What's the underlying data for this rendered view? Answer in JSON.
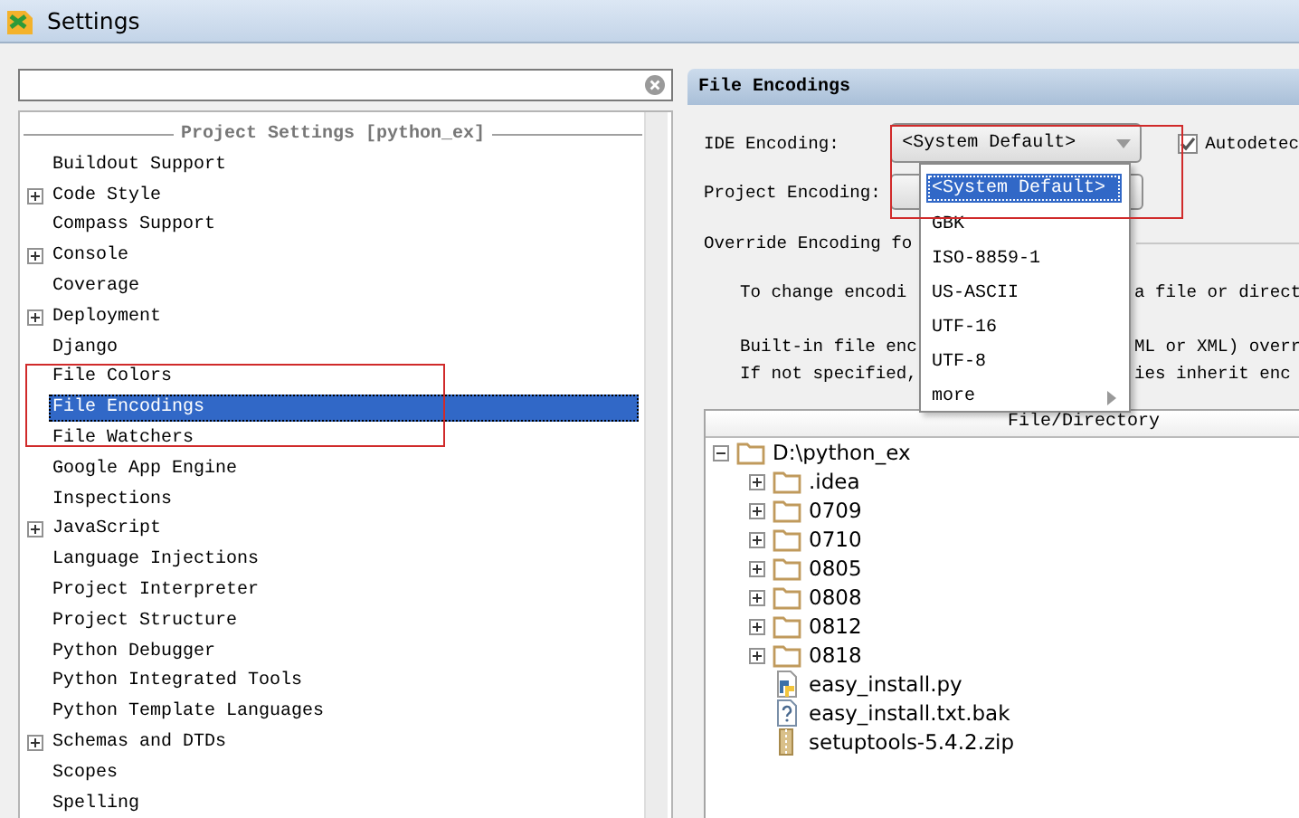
{
  "window": {
    "title": "Settings"
  },
  "sidebar": {
    "section_title": "Project Settings [python_ex]",
    "items": [
      {
        "label": "Buildout Support",
        "expandable": false,
        "selected": false
      },
      {
        "label": "Code Style",
        "expandable": true,
        "selected": false
      },
      {
        "label": "Compass Support",
        "expandable": false,
        "selected": false
      },
      {
        "label": "Console",
        "expandable": true,
        "selected": false
      },
      {
        "label": "Coverage",
        "expandable": false,
        "selected": false
      },
      {
        "label": "Deployment",
        "expandable": true,
        "selected": false
      },
      {
        "label": "Django",
        "expandable": false,
        "selected": false
      },
      {
        "label": "File Colors",
        "expandable": false,
        "selected": false
      },
      {
        "label": "File Encodings",
        "expandable": false,
        "selected": true
      },
      {
        "label": "File Watchers",
        "expandable": false,
        "selected": false
      },
      {
        "label": "Google App Engine",
        "expandable": false,
        "selected": false
      },
      {
        "label": "Inspections",
        "expandable": false,
        "selected": false
      },
      {
        "label": "JavaScript",
        "expandable": true,
        "selected": false
      },
      {
        "label": "Language Injections",
        "expandable": false,
        "selected": false
      },
      {
        "label": "Project Interpreter",
        "expandable": false,
        "selected": false
      },
      {
        "label": "Project Structure",
        "expandable": false,
        "selected": false
      },
      {
        "label": "Python Debugger",
        "expandable": false,
        "selected": false
      },
      {
        "label": "Python Integrated Tools",
        "expandable": false,
        "selected": false
      },
      {
        "label": "Python Template Languages",
        "expandable": false,
        "selected": false
      },
      {
        "label": "Schemas and DTDs",
        "expandable": true,
        "selected": false
      },
      {
        "label": "Scopes",
        "expandable": false,
        "selected": false
      },
      {
        "label": "Spelling",
        "expandable": false,
        "selected": false
      }
    ]
  },
  "panel": {
    "title": "File Encodings",
    "ide_encoding": {
      "label": "IDE Encoding:",
      "value": "<System Default>"
    },
    "autodetect": {
      "label": "Autodetec",
      "checked": true
    },
    "project_encoding": {
      "label": "Project Encoding:"
    },
    "override_label": "Override Encoding fo",
    "paragraphs": [
      [
        {
          "left": "To change encodi",
          "right": "a file or direct"
        }
      ],
      [
        {
          "left": "Built-in file enc",
          "right": "ML or XML) overr"
        },
        {
          "left": "If not specified,",
          "right": "ies inherit enc"
        }
      ]
    ],
    "table": {
      "columns": [
        "File/Directory"
      ],
      "tree": {
        "label": "D:\\python_ex",
        "kind": "folder",
        "expanded": true,
        "children": [
          {
            "label": ".idea",
            "kind": "folder",
            "expanded": false
          },
          {
            "label": "0709",
            "kind": "folder",
            "expanded": false
          },
          {
            "label": "0710",
            "kind": "folder",
            "expanded": false
          },
          {
            "label": "0805",
            "kind": "folder",
            "expanded": false
          },
          {
            "label": "0808",
            "kind": "folder",
            "expanded": false
          },
          {
            "label": "0812",
            "kind": "folder",
            "expanded": false
          },
          {
            "label": "0818",
            "kind": "folder",
            "expanded": false
          },
          {
            "label": "easy_install.py",
            "kind": "python"
          },
          {
            "label": "easy_install.txt.bak",
            "kind": "unknown"
          },
          {
            "label": "setuptools-5.4.2.zip",
            "kind": "archive"
          }
        ]
      }
    },
    "dropdown": {
      "items": [
        {
          "label": "<System Default>",
          "kind": "option",
          "selected": true
        },
        {
          "label": "GBK",
          "kind": "option",
          "selected": false
        },
        {
          "label": "ISO-8859-1",
          "kind": "option",
          "selected": false
        },
        {
          "label": "US-ASCII",
          "kind": "option",
          "selected": false
        },
        {
          "label": "UTF-16",
          "kind": "option",
          "selected": false
        },
        {
          "label": "UTF-8",
          "kind": "option",
          "selected": false
        },
        {
          "label": "more",
          "kind": "submenu",
          "selected": false
        }
      ]
    }
  }
}
